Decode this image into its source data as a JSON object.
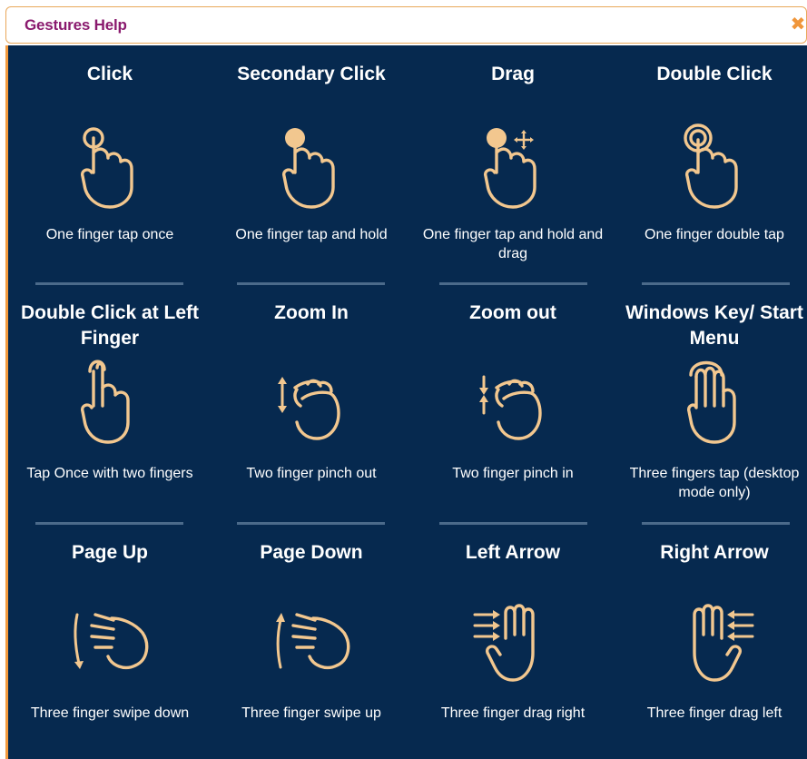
{
  "dialog": {
    "title": "Gestures Help",
    "close_glyph": "✖"
  },
  "colors": {
    "panel_bg": "#06294f",
    "accent": "#f39a3d",
    "title_color": "#8a1a6e",
    "icon_color": "#f2c78f"
  },
  "gestures": [
    {
      "name": "Click",
      "desc": "One finger tap once",
      "icon": "one-finger-tap-icon"
    },
    {
      "name": "Secondary Click",
      "desc": "One finger tap and hold",
      "icon": "one-finger-hold-icon"
    },
    {
      "name": "Drag",
      "desc": "One finger tap and hold and drag",
      "icon": "one-finger-drag-icon"
    },
    {
      "name": "Double Click",
      "desc": "One finger double tap",
      "icon": "one-finger-double-tap-icon"
    },
    {
      "name": "Double Click at Left Finger",
      "desc": "Tap Once with two fingers",
      "icon": "two-finger-tap-icon"
    },
    {
      "name": "Zoom In",
      "desc": "Two finger pinch out",
      "icon": "pinch-out-icon"
    },
    {
      "name": "Zoom out",
      "desc": "Two finger pinch in",
      "icon": "pinch-in-icon"
    },
    {
      "name": "Windows Key/ Start Menu",
      "desc": "Three fingers tap (desktop mode only)",
      "icon": "three-finger-tap-icon"
    },
    {
      "name": "Page Up",
      "desc": "Three finger swipe down",
      "icon": "swipe-down-icon"
    },
    {
      "name": "Page Down",
      "desc": "Three finger swipe up",
      "icon": "swipe-up-icon"
    },
    {
      "name": "Left Arrow",
      "desc": "Three finger drag right",
      "icon": "drag-right-icon"
    },
    {
      "name": "Right Arrow",
      "desc": "Three finger drag left",
      "icon": "drag-left-icon"
    }
  ]
}
